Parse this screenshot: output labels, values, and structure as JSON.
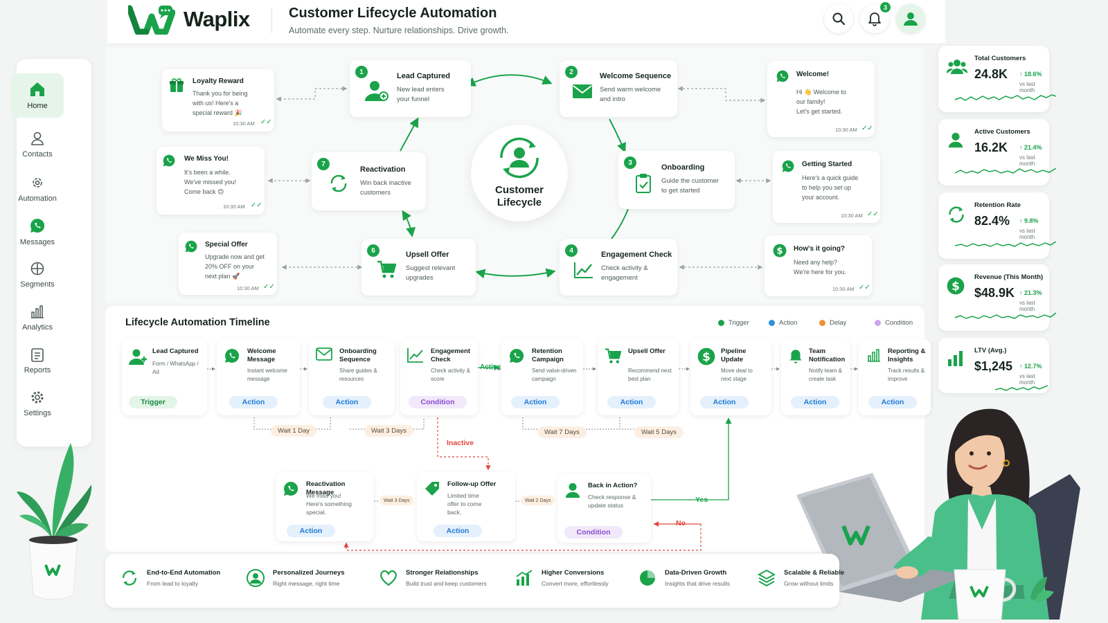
{
  "brand": {
    "name": "Waplix",
    "accent": "#1aa34a",
    "green_dark": "#16823b"
  },
  "header": {
    "title": "Customer Lifecycle Automation",
    "subtitle": "Automate every step. Nurture relationships. Drive growth.",
    "notif_count": "3"
  },
  "sidebar": {
    "items": [
      {
        "label": "Home",
        "icon": "home-icon"
      },
      {
        "label": "Contacts",
        "icon": "user-icon"
      },
      {
        "label": "Automation",
        "icon": "gear-puzzle-icon"
      },
      {
        "label": "Messages",
        "icon": "whatsapp-icon"
      },
      {
        "label": "Segments",
        "icon": "segments-icon"
      },
      {
        "label": "Analytics",
        "icon": "bar-chart-icon"
      },
      {
        "label": "Reports",
        "icon": "clipboard-icon"
      },
      {
        "label": "Settings",
        "icon": "settings-icon"
      }
    ]
  },
  "lifecycle": {
    "center": {
      "line1": "Customer",
      "line2": "Lifecycle"
    },
    "stages": [
      {
        "num": "1",
        "title": "Lead Captured",
        "desc1": "New lead enters",
        "desc2": "your funnel"
      },
      {
        "num": "2",
        "title": "Welcome Sequence",
        "desc1": "Send warm welcome",
        "desc2": "and intro"
      },
      {
        "num": "3",
        "title": "Onboarding",
        "desc1": "Guide the customer",
        "desc2": "to get started"
      },
      {
        "num": "4",
        "title": "Engagement Check",
        "desc1": "Check activity &",
        "desc2": "engagement"
      },
      {
        "num": "6",
        "title": "Upsell Offer",
        "desc1": "Suggest relevant",
        "desc2": "upgrades"
      },
      {
        "num": "7",
        "title": "Reactivation",
        "desc1": "Win back inactive",
        "desc2": "customers"
      }
    ],
    "messages": [
      {
        "title": "Loyalty Reward",
        "lines": [
          "Thank you for being",
          "with us! Here's a",
          "special reward 🎉"
        ],
        "time": "10:30 AM"
      },
      {
        "title": "We Miss You!",
        "lines": [
          "It's been a while.",
          "We've missed you!",
          "Come back 😊"
        ],
        "time": "10:30 AM"
      },
      {
        "title": "Special Offer",
        "lines": [
          "Upgrade now and get",
          "20% OFF on your",
          "next plan 🚀"
        ],
        "time": "10:30 AM"
      },
      {
        "title": "Welcome!",
        "lines": [
          "Hi 👋 Welcome to",
          "our family!",
          "Let's get started."
        ],
        "time": "10:30 AM"
      },
      {
        "title": "Getting Started",
        "lines": [
          "Here's a quick guide",
          "to help you set up",
          "your account."
        ],
        "time": "10:30 AM"
      },
      {
        "title": "How's it going?",
        "lines": [
          "Need any help?",
          "We're here for you."
        ],
        "time": "10:30 AM"
      }
    ]
  },
  "timeline": {
    "title": "Lifecycle Automation Timeline",
    "legend": [
      {
        "label": "Trigger",
        "color": "#1aa34a"
      },
      {
        "label": "Action",
        "color": "#2f8fe0"
      },
      {
        "label": "Delay",
        "color": "#f0913a"
      },
      {
        "label": "Condition",
        "color": "#c9a6ef"
      }
    ],
    "steps": [
      {
        "title": "Lead Captured",
        "desc": "Form / WhatsApp / Ad",
        "type": "Trigger"
      },
      {
        "title": "Welcome Message",
        "desc": "Instant welcome message",
        "type": "Action"
      },
      {
        "title": "Onboarding Sequence",
        "desc": "Share guides & resources",
        "type": "Action"
      },
      {
        "title": "Engagement Check",
        "desc": "Check activity & score",
        "type": "Condition"
      },
      {
        "title": "Retention Campaign",
        "desc": "Send value-driven campaign",
        "type": "Action"
      },
      {
        "title": "Upsell Offer",
        "desc": "Recommend next best plan",
        "type": "Action"
      },
      {
        "title": "Pipeline Update",
        "desc": "Move deal to next stage",
        "type": "Action"
      },
      {
        "title": "Team Notification",
        "desc": "Notify team & create task",
        "type": "Action"
      },
      {
        "title": "Reporting & Insights",
        "desc": "Track results & improve",
        "type": "Action"
      }
    ],
    "waits": [
      "Wait 1 Day",
      "Wait 3 Days",
      "Wait 7 Days",
      "Wait 5 Days"
    ],
    "active_label": "Active",
    "inactive_label": "Inactive",
    "branch": [
      {
        "title": "Reactivation Message",
        "desc": "We miss you! Here's something special.",
        "type": "Action"
      },
      {
        "title": "Follow-up Offer",
        "desc": "Limited time offer to come back.",
        "type": "Action"
      },
      {
        "title": "Back in Action?",
        "desc": "Check response & update status",
        "type": "Condition"
      }
    ],
    "branch_waits": [
      "Wait 3 Days",
      "Wait 2 Days"
    ],
    "yes_label": "Yes",
    "no_label": "No"
  },
  "stats": [
    {
      "label": "Total Customers",
      "value": "24.8K",
      "change": "↑ 18.6%",
      "vs": "vs last month",
      "icon": "users-icon"
    },
    {
      "label": "Active Customers",
      "value": "16.2K",
      "change": "↑ 21.4%",
      "vs": "vs last month",
      "icon": "user-icon"
    },
    {
      "label": "Retention Rate",
      "value": "82.4%",
      "change": "↑ 9.8%",
      "vs": "vs last month",
      "icon": "refresh-icon"
    },
    {
      "label": "Revenue (This Month)",
      "value": "$48.9K",
      "change": "↑ 21.3%",
      "vs": "vs last month",
      "icon": "dollar-icon"
    },
    {
      "label": "LTV (Avg.)",
      "value": "$1,245",
      "change": "↑ 12.7%",
      "vs": "vs last month",
      "icon": "bar-chart-icon"
    }
  ],
  "features": [
    {
      "title": "End-to-End Automation",
      "desc": "From lead to loyalty"
    },
    {
      "title": "Personalized Journeys",
      "desc": "Right message, right time"
    },
    {
      "title": "Stronger Relationships",
      "desc": "Build trust and keep customers"
    },
    {
      "title": "Higher Conversions",
      "desc": "Convert more, effortlessly"
    },
    {
      "title": "Data-Driven Growth",
      "desc": "Insights that drive results"
    },
    {
      "title": "Scalable & Reliable",
      "desc": "Grow without limits"
    }
  ]
}
